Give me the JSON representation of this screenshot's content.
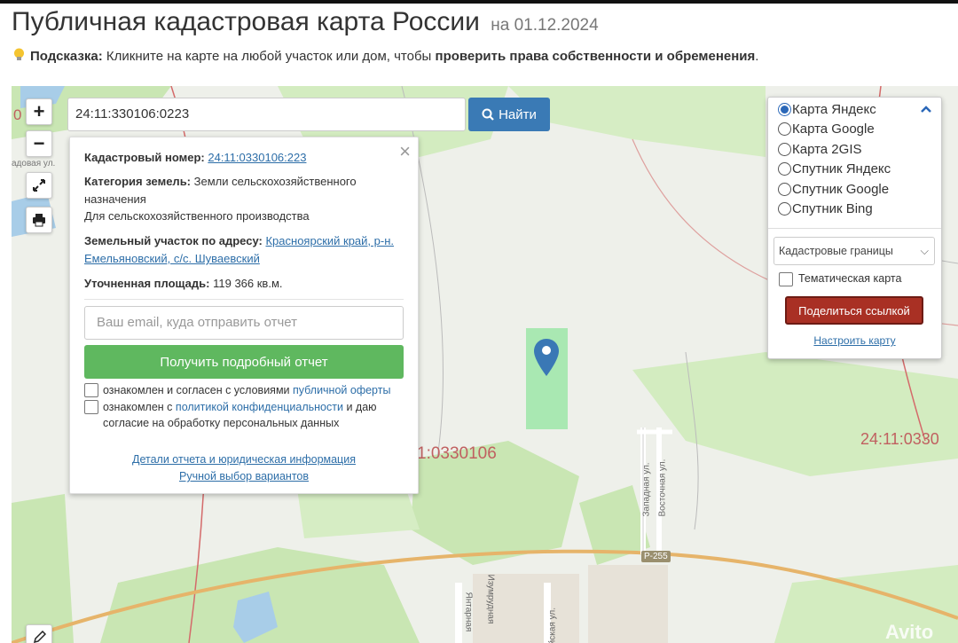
{
  "page": {
    "title": "Публичная кадастровая карта России",
    "date": "на 01.12.2024",
    "hint_label": "Подсказка:",
    "hint_text": "Кликните на карте на любой участок или дом, чтобы",
    "hint_bold": "проверить права собственности и обременения",
    "hint_end": "."
  },
  "controls": {
    "zoom_in": "+",
    "zoom_out": "−",
    "search_value": "24:11:330106:0223",
    "search_button": "Найти"
  },
  "popup": {
    "close": "×",
    "cadastral_label": "Кадастровый номер:",
    "cadastral_value": "24:11:0330106:223",
    "category_label": "Категория земель:",
    "category_value_1": "Земли сельскохозяйственного",
    "category_value_2": "назначения",
    "usage": "Для сельскохозяйственного производства",
    "address_label": "Земельный участок по адресу:",
    "address_value_1": "Красноярский край, р-н.",
    "address_value_2": "Емельяновский, с/с. Шуваевский",
    "area_label": "Уточненная площадь:",
    "area_value": "119 366 кв.м.",
    "email_placeholder": "Ваш email, куда отправить отчет",
    "report_button": "Получить подробный отчет",
    "consent1_text": "ознакомлен и согласен с условиями",
    "consent1_link": "публичной оферты",
    "consent2_text": "ознакомлен с",
    "consent2_link": "политикой конфиденциальности",
    "consent2_mid": "и даю",
    "consent2_link2": "согласие на обработку персональных данных",
    "details_link": "Детали отчета и юридическая информация",
    "manual_link": "Ручной выбор вариантов"
  },
  "layers": {
    "options": [
      {
        "label": "Карта Яндекс",
        "checked": true
      },
      {
        "label": "Карта Google",
        "checked": false
      },
      {
        "label": "Карта 2GIS",
        "checked": false
      },
      {
        "label": "Спутник Яндекс",
        "checked": false
      },
      {
        "label": "Спутник Google",
        "checked": false
      },
      {
        "label": "Спутник Bing",
        "checked": false
      }
    ],
    "select_value": "Кадастровые границы",
    "thematic_label": "Тематическая карта",
    "share_button": "Поделиться ссылкой",
    "configure_link": "Настроить карту"
  },
  "map_labels": {
    "quarter_center": "1:0330106",
    "quarter_right": "24:11:0330",
    "street_left": "адовая ул.",
    "street_zapadnaya": "Западная ул.",
    "street_vostochnaya": "Восточная ул.",
    "road": "Р-255",
    "street_izumrudnaya": "Изумрудная",
    "street_yantarnaya": "Янтарная",
    "street_listvennaya": "тийская ул.",
    "watermark": "Avito",
    "quarter_left_edge": "0"
  },
  "colors": {
    "accent_blue": "#3a7ab5",
    "green_button": "#5fb85f",
    "share_red": "#a93024",
    "parcel_green": "#a9e8b2",
    "marker_blue": "#3a78b5",
    "forest": "#c9e6b3",
    "road_orange": "#e6b46a",
    "boundary_red": "#d46a6a"
  }
}
